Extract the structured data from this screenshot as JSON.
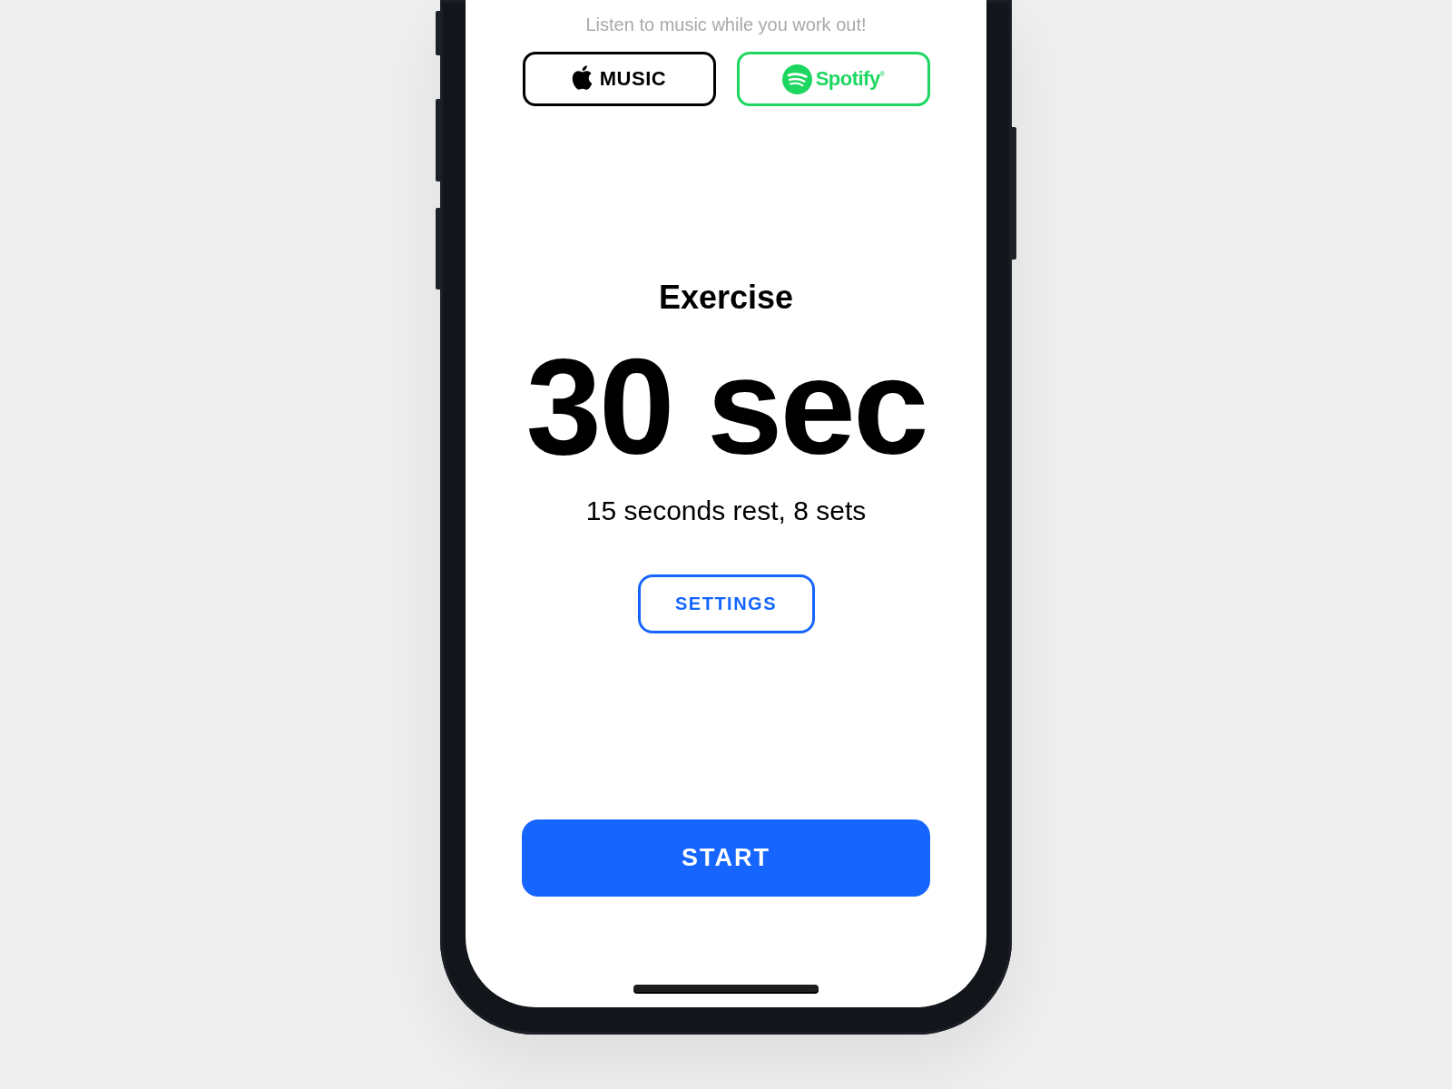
{
  "prompt": "Listen to music while you work out!",
  "music_services": [
    {
      "kind": "apple",
      "label": "MUSIC"
    },
    {
      "kind": "spotify",
      "label": "Spotify$^{®}$"
    }
  ],
  "workout": {
    "title": "Exercise",
    "duration": "30 sec",
    "summary": "15 seconds rest, 8 sets"
  },
  "settings_button": "SETTINGS",
  "start_button": "START"
}
